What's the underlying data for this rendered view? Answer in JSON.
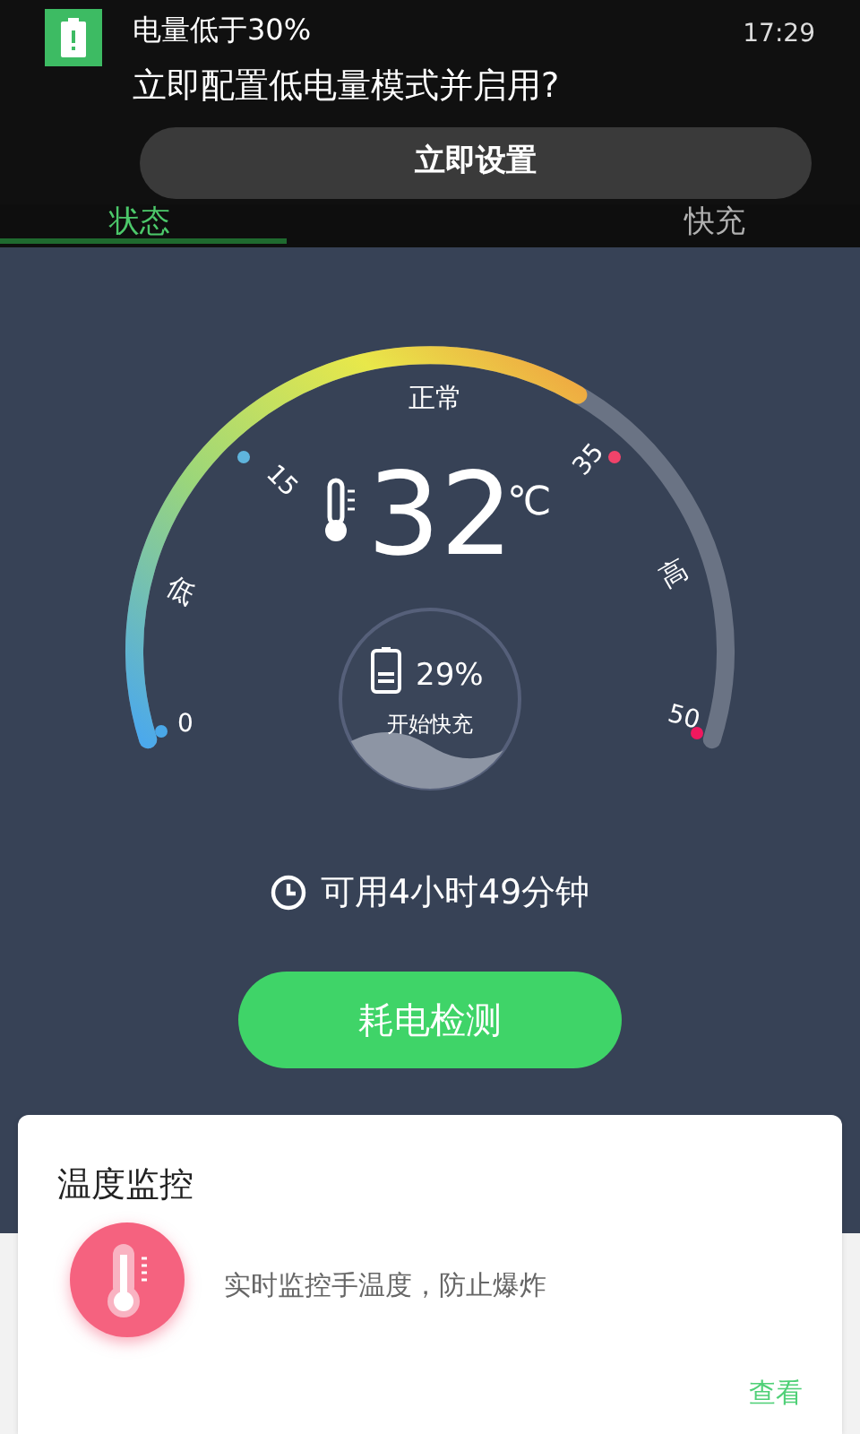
{
  "notification": {
    "title": "电量低于30%",
    "time": "17:29",
    "message": "立即配置低电量模式并启用?",
    "action": "立即设置"
  },
  "tabs": [
    {
      "label": "状态",
      "selected": true
    },
    {
      "label": "快充",
      "selected": false
    }
  ],
  "gauge": {
    "temperature": "32",
    "unit": "℃",
    "zones": [
      "低",
      "正常",
      "高"
    ],
    "ticks": [
      {
        "label": "0",
        "color": "#4aa8e8"
      },
      {
        "label": "15",
        "color": "#5fb4dc"
      },
      {
        "label": "35",
        "color": "#f0436a"
      },
      {
        "label": "50",
        "color": "#f0185e"
      }
    ],
    "battery": {
      "percent": "29%",
      "status": "开始快充"
    }
  },
  "remaining": "可用4小时49分钟",
  "check_button": "耗电检测",
  "card": {
    "title": "温度监控",
    "description": "实时监控手温度，防止爆炸",
    "link": "查看"
  }
}
